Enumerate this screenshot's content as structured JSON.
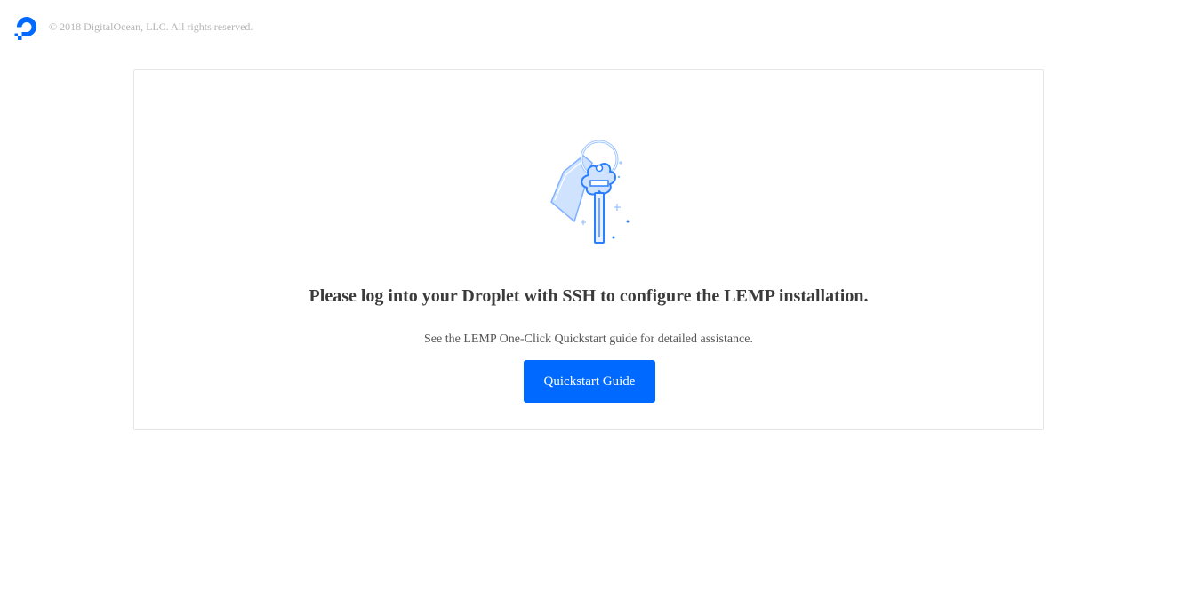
{
  "header": {
    "logo_icon": "digitalocean-logo-icon",
    "copyright": "© 2018 DigitalOcean, LLC. All rights reserved."
  },
  "card": {
    "illustration_icon": "key-with-tag-icon",
    "headline": "Please log into your Droplet with SSH to configure the LEMP installation.",
    "subtext": "See the LEMP One-Click Quickstart guide for detailed assistance.",
    "button_label": "Quickstart Guide"
  },
  "colors": {
    "brand_blue": "#0069ff",
    "illustration_light": "#cfe3ff",
    "illustration_stroke": "#4a90ff"
  }
}
